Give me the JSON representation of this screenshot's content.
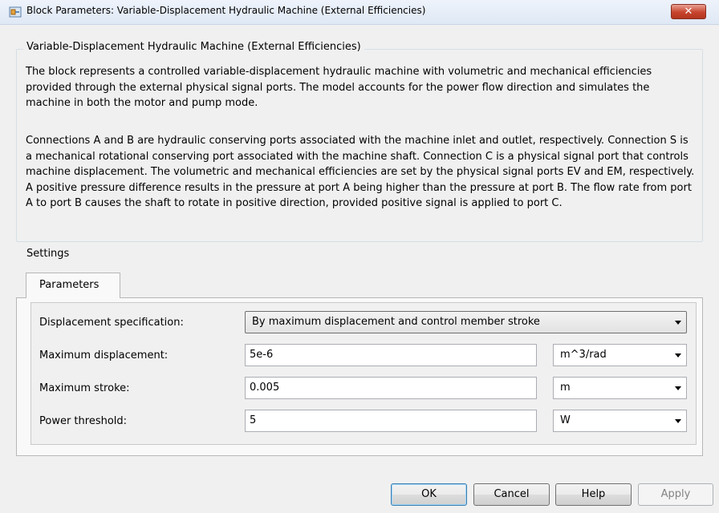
{
  "window": {
    "title": "Block Parameters: Variable-Displacement Hydraulic Machine (External Efficiencies)",
    "close_glyph": "✕"
  },
  "description_group": {
    "legend": "Variable-Displacement Hydraulic Machine (External Efficiencies)",
    "paragraph1": "The block represents a controlled variable-displacement hydraulic machine with volumetric and mechanical efficiencies provided through the external physical signal ports. The model accounts for the power flow direction and simulates the machine in both the motor and pump mode.",
    "paragraph2": "Connections A and B are hydraulic conserving ports associated with the machine inlet and outlet, respectively. Connection S is a mechanical rotational conserving port associated with the machine shaft. Connection C is a physical signal port that controls machine displacement. The volumetric and mechanical efficiencies are set by the physical signal ports EV and EM, respectively. A positive pressure difference results in the pressure at port A being higher than the pressure at port B. The flow rate from port A to port B causes the shaft to rotate in positive direction, provided positive signal is applied to port C."
  },
  "settings": {
    "legend": "Settings",
    "tabs": [
      {
        "label": "Parameters",
        "active": true
      }
    ],
    "params": {
      "displacement_spec": {
        "label": "Displacement specification:",
        "value": "By maximum displacement and control member stroke"
      },
      "max_displacement": {
        "label": "Maximum displacement:",
        "value": "5e-6",
        "unit": "m^3/rad"
      },
      "max_stroke": {
        "label": "Maximum stroke:",
        "value": "0.005",
        "unit": "m"
      },
      "power_threshold": {
        "label": "Power threshold:",
        "value": "5",
        "unit": "W"
      }
    }
  },
  "buttons": {
    "ok": "OK",
    "cancel": "Cancel",
    "help": "Help",
    "apply": "Apply"
  },
  "colors": {
    "accent": "#3c7fb1",
    "close": "#c7432d",
    "group_border": "#d5dfe5"
  }
}
